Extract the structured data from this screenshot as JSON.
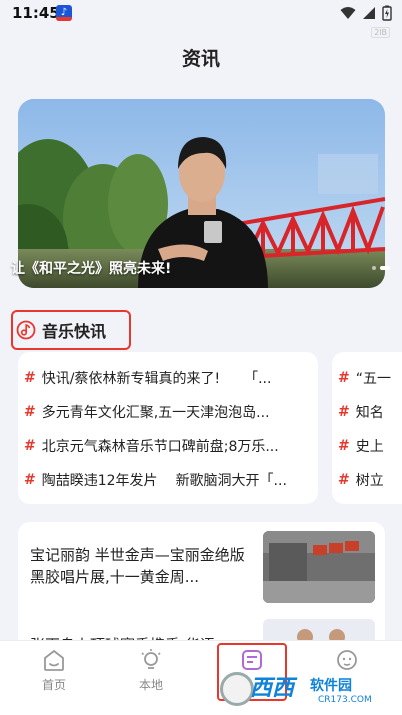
{
  "status_bar": {
    "time": "11:45",
    "mini_label": "2lB"
  },
  "header": {
    "title": "资讯"
  },
  "banner": {
    "caption": "让《和平之光》照亮未来!"
  },
  "section": {
    "title": "音乐快讯"
  },
  "news_card_1": {
    "items": [
      {
        "text": "快讯/蔡依林新专辑真的来了!",
        "tail": "「..."
      },
      {
        "text": "多元青年文化汇聚,五一天津泡泡岛..."
      },
      {
        "text": "北京元气森林音乐节口碑前盘;8万乐..."
      },
      {
        "text": "陶喆睽违12年发片",
        "tail": "新歌脑洞大开「..."
      }
    ]
  },
  "news_card_2": {
    "items": [
      {
        "text": "“五一"
      },
      {
        "text": "知名"
      },
      {
        "text": "史上"
      },
      {
        "text": "树立"
      }
    ]
  },
  "articles": [
    {
      "title": "宝记丽韵 半世金声—宝丽金绝版黑胶唱片展,十一黄金周..."
    },
    {
      "title": "张百鸟上顶球赛手携手,华语"
    }
  ],
  "tabs": [
    {
      "label": "首页"
    },
    {
      "label": "本地"
    },
    {
      "label": ""
    },
    {
      "label": ""
    }
  ],
  "watermark": {
    "big": "西西",
    "sub": "软件园",
    "url": "CR173.COM"
  },
  "colors": {
    "accent": "#e8372c",
    "background": "#f2f3f8"
  }
}
